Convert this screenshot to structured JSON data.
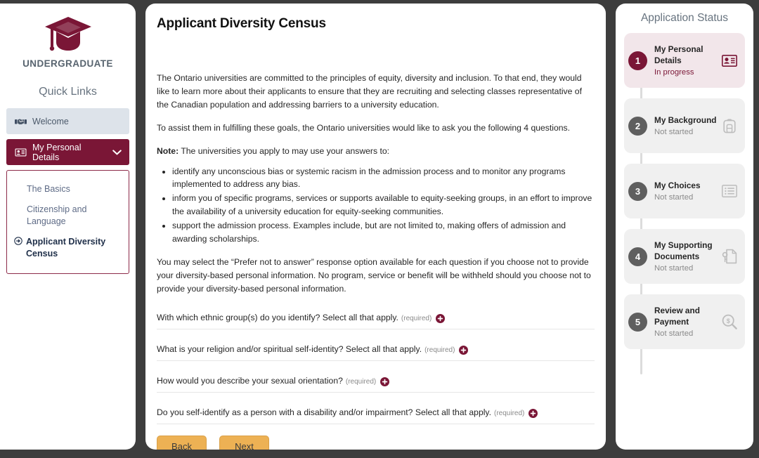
{
  "sidebar": {
    "logo_icon": "graduation-cap-icon",
    "brand": "UNDERGRADUATE",
    "quick_links_title": "Quick Links",
    "items": [
      {
        "label": "Welcome",
        "icon": "handshake-icon",
        "state": "normal"
      },
      {
        "label": "My Personal Details",
        "icon": "id-card-icon",
        "state": "active",
        "chevron": "⌄"
      }
    ],
    "submenu": [
      {
        "label": "The Basics",
        "current": false
      },
      {
        "label": "Citizenship and Language",
        "current": false
      },
      {
        "label": "Applicant Diversity Census",
        "current": true,
        "bullet_icon": "circle-arrow-right-icon"
      }
    ]
  },
  "main": {
    "title": "Applicant Diversity Census",
    "intro_1": "The Ontario universities are committed to the principles of equity, diversity and inclusion. To that end, they would like to learn more about their applicants to ensure that they are recruiting and selecting classes representative of the Canadian population and addressing barriers to a university education.",
    "intro_2": "To assist them in fulfilling these goals, the Ontario universities would like to ask you the following 4 questions.",
    "note_label": "Note:",
    "note_text": " The universities you apply to may use your answers to:",
    "bullets": [
      "identify any unconscious bias or systemic racism in the admission process and to monitor any programs implemented to address any bias.",
      "inform you of specific programs, services or supports available to equity-seeking groups, in an effort to improve the availability of a university education for equity-seeking communities.",
      "support the admission process. Examples include, but are not limited to, making offers of admission and awarding scholarships."
    ],
    "closing": "You may select the “Prefer not to answer” response option available for each question if you choose not to provide your diversity-based personal information. No program, service or benefit will be withheld should you choose not to provide your diversity-based personal information.",
    "required_label": "(required)",
    "expand_icon": "plus-circle-icon",
    "questions": [
      "With which ethnic group(s) do you identify? Select all that apply.",
      "What is your religion and/or spiritual self-identity? Select all that apply.",
      "How would you describe your sexual orientation?",
      "Do you self-identify as a person with a disability and/or impairment? Select all that apply."
    ],
    "back_label": "Back",
    "next_label": "Next"
  },
  "status": {
    "title": "Application Status",
    "steps": [
      {
        "num": "1",
        "name": "My Personal Details",
        "state": "In progress",
        "icon": "id-card-icon",
        "current": true
      },
      {
        "num": "2",
        "name": "My Background",
        "state": "Not started",
        "icon": "backpack-icon",
        "current": false
      },
      {
        "num": "3",
        "name": "My Choices",
        "state": "Not started",
        "icon": "list-icon",
        "current": false
      },
      {
        "num": "4",
        "name": "My Supporting Documents",
        "state": "Not started",
        "icon": "document-key-icon",
        "current": false
      },
      {
        "num": "5",
        "name": "Review and Payment",
        "state": "Not started",
        "icon": "magnifier-dollar-icon",
        "current": false
      }
    ]
  },
  "colors": {
    "brand_maroon": "#7a1636",
    "accent_amber": "#edb154",
    "page_background": "#3d3d3d",
    "panel_white": "#ffffff",
    "step_gray": "#5f5f5f"
  }
}
